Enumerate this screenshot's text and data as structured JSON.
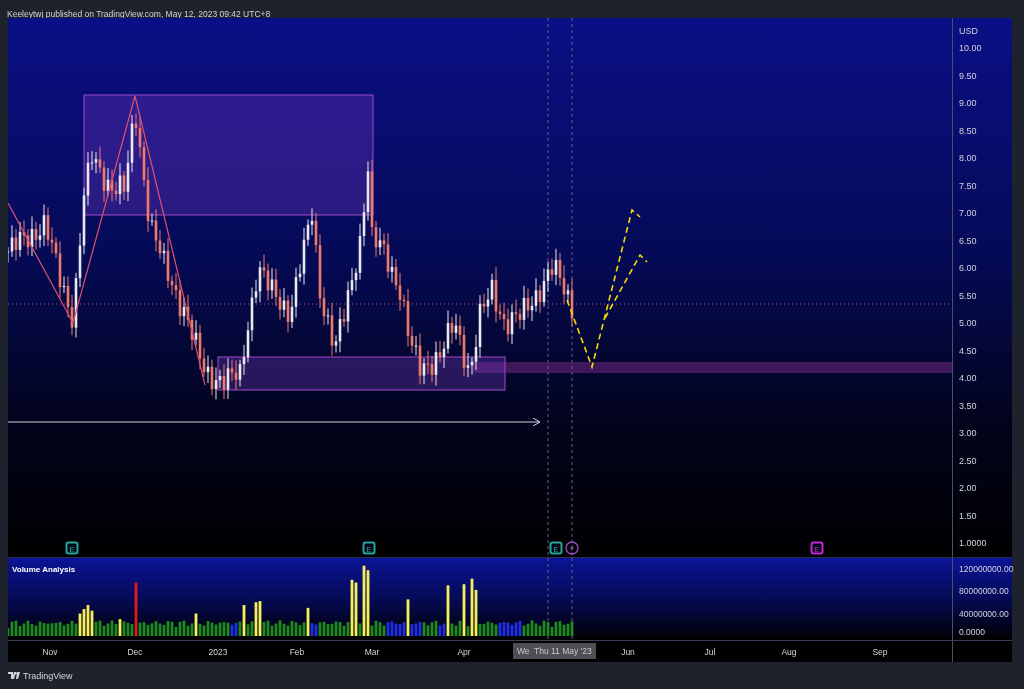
{
  "header": {
    "text": "Keeleytwj published on TradingView.com, May 12, 2023 09:42 UTC+8"
  },
  "price_axis": {
    "currency": "USD",
    "labels": [
      "10.00",
      "9.50",
      "9.00",
      "8.50",
      "8.00",
      "7.50",
      "7.00",
      "6.50",
      "6.00",
      "5.50",
      "5.00",
      "4.50",
      "4.00",
      "3.50",
      "3.00",
      "2.50",
      "2.00",
      "1.50",
      "1.0000"
    ]
  },
  "events": [
    {
      "kind": "earnings",
      "label": "E",
      "color": "#26a69a"
    },
    {
      "kind": "earnings",
      "label": "E",
      "color": "#26a69a"
    },
    {
      "kind": "earnings",
      "label": "E",
      "color": "#26a69a"
    },
    {
      "kind": "news",
      "color": "#9c4dcc"
    },
    {
      "kind": "earnings",
      "label": "E",
      "color": "#c026d3"
    }
  ],
  "volume_pane": {
    "title": "Volume Analysis",
    "axis_labels": [
      "120000000.00",
      "80000000.00",
      "40000000.00",
      "0.0000"
    ]
  },
  "time_axis": {
    "labels": [
      "Nov",
      "Dec",
      "2023",
      "Feb",
      "Mar",
      "Apr",
      "Jun",
      "Jul",
      "Aug",
      "Sep"
    ],
    "crosshair_labels": [
      "We",
      "Thu 11 May '23"
    ]
  },
  "footer": {
    "brand": "TradingView"
  }
}
